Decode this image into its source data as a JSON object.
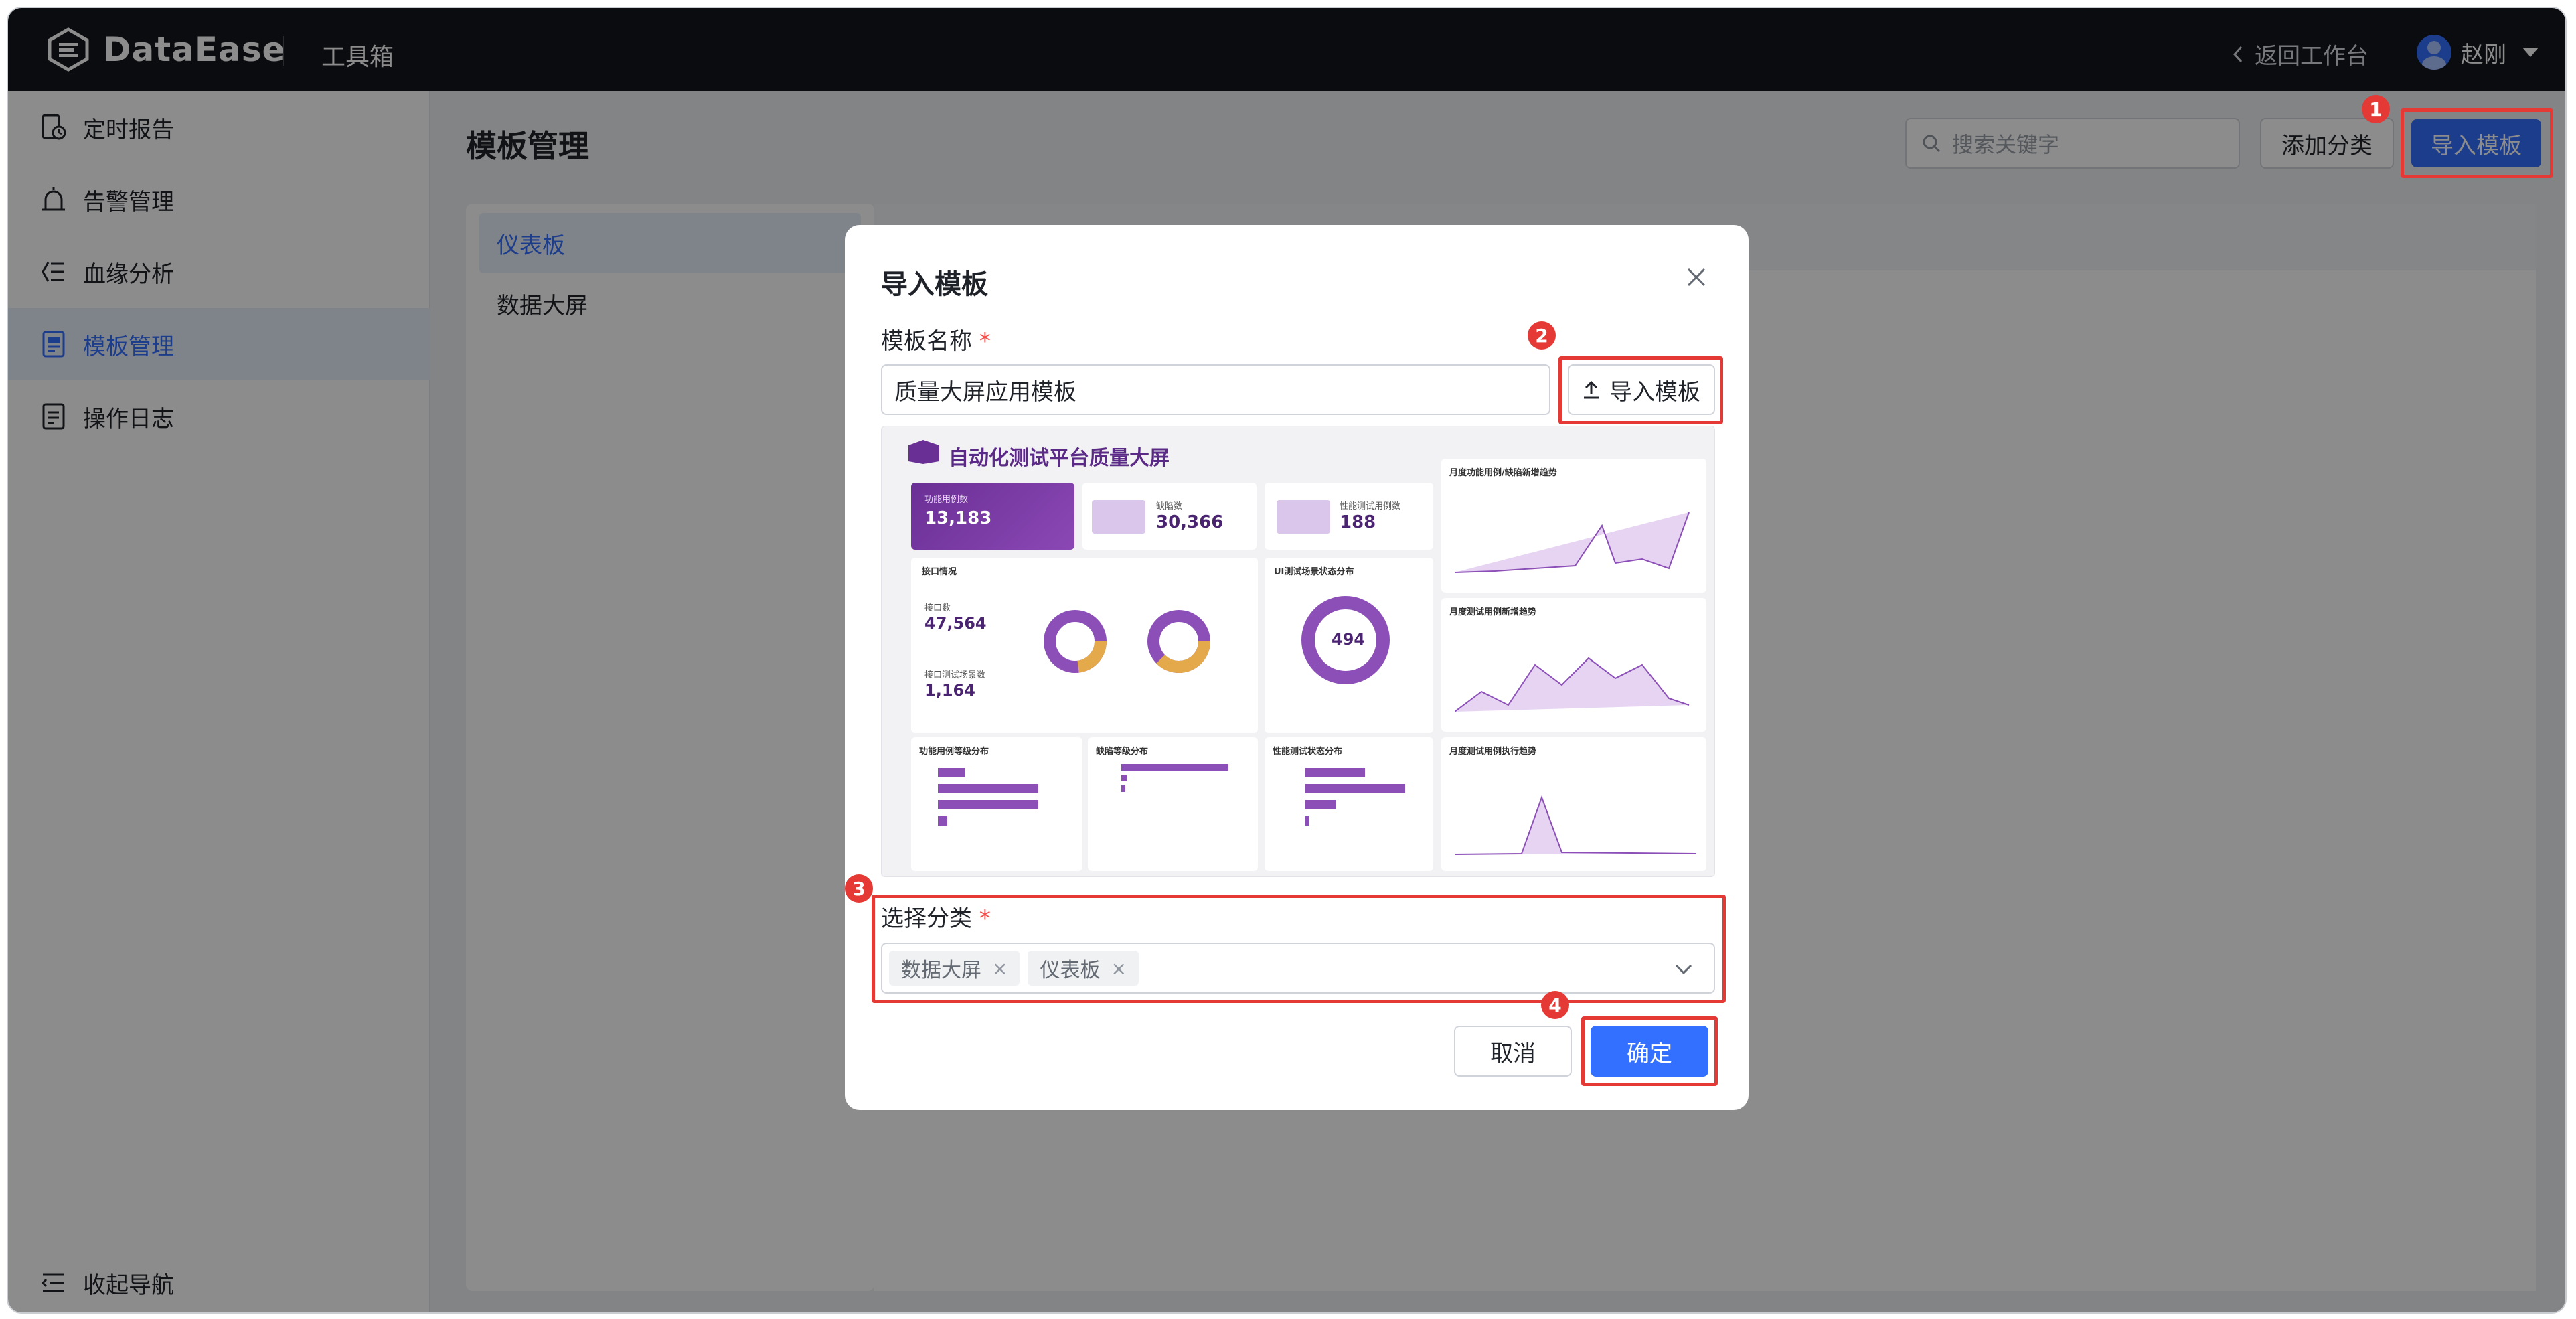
{
  "app": {
    "logo_text": "DataEase",
    "toolbox": "工具箱",
    "back_label": "返回工作台",
    "user_name": "赵刚"
  },
  "sidebar": {
    "items": [
      {
        "label": "定时报告",
        "icon": "report-clock-icon"
      },
      {
        "label": "告警管理",
        "icon": "alarm-icon"
      },
      {
        "label": "血缘分析",
        "icon": "lineage-icon"
      },
      {
        "label": "模板管理",
        "icon": "template-icon",
        "active": true
      },
      {
        "label": "操作日志",
        "icon": "log-icon"
      }
    ],
    "collapse_label": "收起导航"
  },
  "page": {
    "title": "模板管理",
    "search_placeholder": "搜索关键字",
    "add_category_label": "添加分类",
    "import_label": "导入模板",
    "categories": [
      "仪表板",
      "数据大屏"
    ]
  },
  "dialog": {
    "title": "导入模板",
    "name_label": "模板名称",
    "required_mark": "*",
    "name_value": "质量大屏应用模板",
    "upload_label": "导入模板",
    "category_label": "选择分类",
    "selected_tags": [
      "数据大屏",
      "仪表板"
    ],
    "tag_remove": "×",
    "cancel_label": "取消",
    "ok_label": "确定",
    "preview": {
      "title": "自动化测试平台质量大屏",
      "hero_label": "功能用例数",
      "hero_value": "13,183",
      "defects_label": "缺陷数",
      "defects_value": "30,366",
      "perf_label": "性能测试用例数",
      "perf_value": "188",
      "api_section": "接口情况",
      "api_count_label": "接口数",
      "api_count": "47,564",
      "api_case_label": "接口测试场景数",
      "api_case_count": "1,164",
      "ui_section": "UI测试场景状态分布",
      "ui_total": "494",
      "trend1": "月度功能用例/缺陷新增趋势",
      "trend2": "月度测试用例新增趋势",
      "trend3": "月度测试用例执行趋势",
      "bar1": "功能用例等级分布",
      "bar2": "缺陷等级分布",
      "bar3": "性能测试状态分布"
    }
  },
  "annotations": [
    "1",
    "2",
    "3",
    "4"
  ],
  "colors": {
    "accent": "#3370ff",
    "annotation": "#e53935",
    "topbar": "#14161c",
    "preview_purple": "#6a2f95"
  }
}
